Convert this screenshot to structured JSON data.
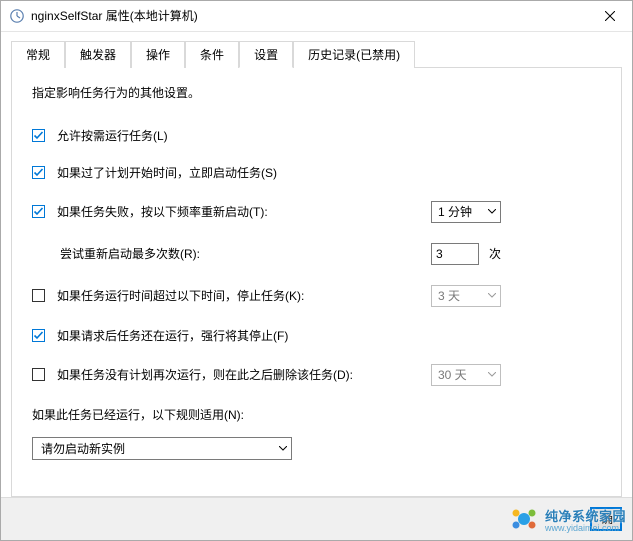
{
  "window": {
    "title": "nginxSelfStar 属性(本地计算机)"
  },
  "tabs": {
    "general": "常规",
    "triggers": "触发器",
    "actions": "操作",
    "conditions": "条件",
    "settings": "设置",
    "history": "历史记录(已禁用)"
  },
  "panel": {
    "desc": "指定影响任务行为的其他设置。",
    "allow_demand": "允许按需运行任务(L)",
    "run_asap": "如果过了计划开始时间，立即启动任务(S)",
    "restart_if_fail": "如果任务失败，按以下频率重新启动(T):",
    "restart_interval": "1 分钟",
    "restart_attempts_label": "尝试重新启动最多次数(R):",
    "restart_attempts": "3",
    "restart_attempts_unit": "次",
    "stop_if_long": "如果任务运行时间超过以下时间，停止任务(K):",
    "stop_if_long_val": "3 天",
    "force_stop": "如果请求后任务还在运行，强行将其停止(F)",
    "delete_if_not_sched": "如果任务没有计划再次运行，则在此之后删除该任务(D):",
    "delete_after_val": "30 天",
    "already_running": "如果此任务已经运行，以下规则适用(N):",
    "rule_select": "请勿启动新实例"
  },
  "footer": {
    "ok": "确"
  },
  "watermark": {
    "text": "纯净系统家园",
    "sub": "www.yidaimei.com"
  }
}
